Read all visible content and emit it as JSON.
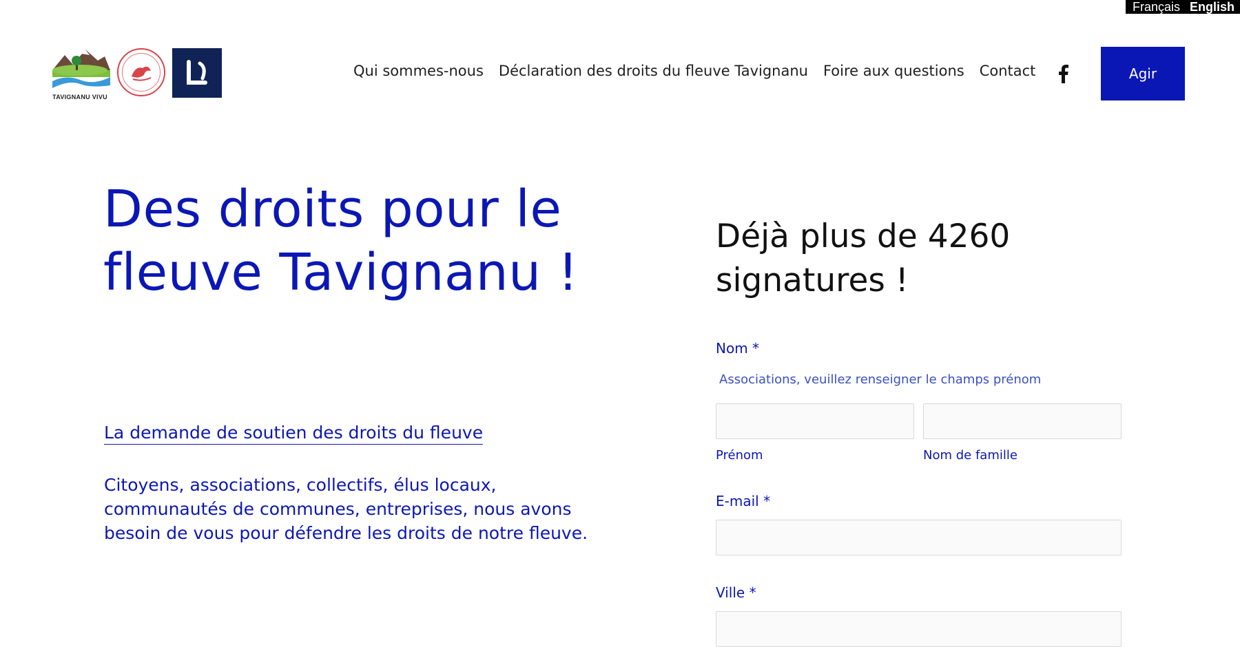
{
  "lang": {
    "french": "Français",
    "english": "English"
  },
  "header": {
    "logo_tavignanu_caption": "TAVIGNANU VIVU",
    "nav": [
      "Qui sommes-nous",
      "Déclaration des droits du fleuve Tavignanu",
      "Foire aux questions",
      "Contact"
    ],
    "cta_label": "Agir"
  },
  "hero": {
    "title": "Des droits pour le fleuve Tavignanu !",
    "support_link": "La demande de soutien des droits du fleuve",
    "description": "Citoyens, associations, collectifs, élus locaux, communautés de communes, entreprises, nous avons besoin de vous pour défendre les droits de notre fleuve."
  },
  "form": {
    "title": "Déjà plus de 4260 signatures !",
    "nom_label": "Nom *",
    "nom_hint": "Associations, veuillez renseigner le champs prénom",
    "prenom_label": "Prénom",
    "nom_famille_label": "Nom de famille",
    "email_label": "E-mail *",
    "ville_label": "Ville *"
  },
  "colors": {
    "accent": "#0b17b5",
    "lang_bar": "#000000"
  }
}
